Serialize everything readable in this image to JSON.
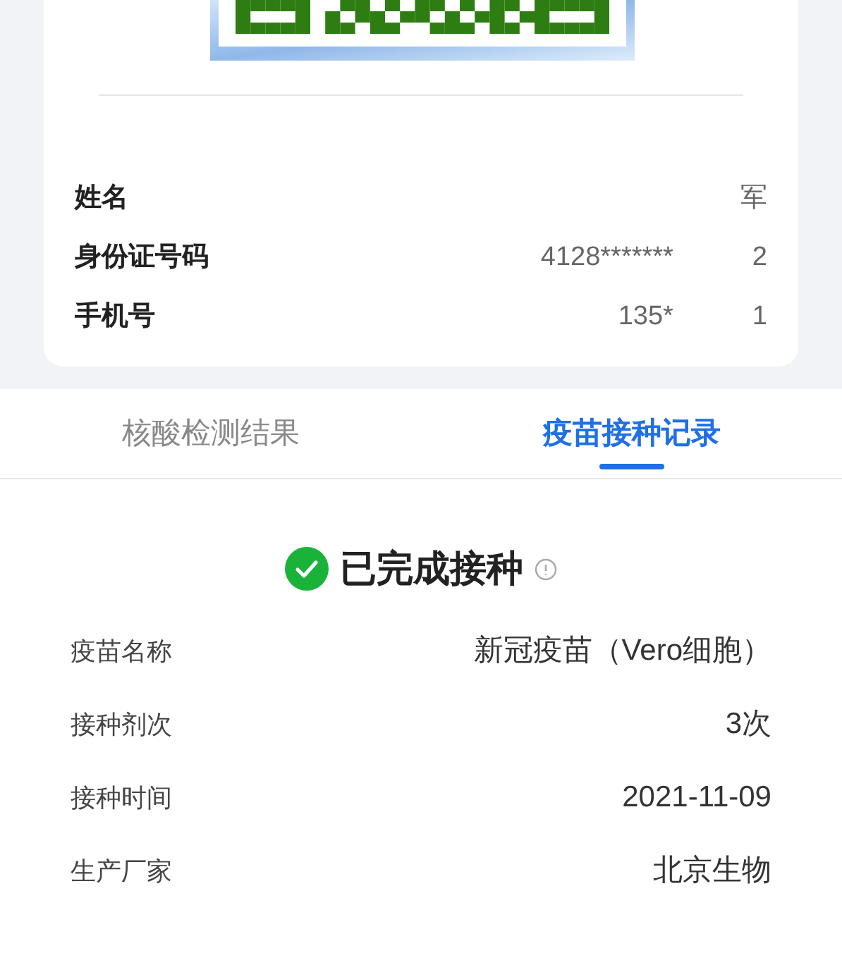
{
  "person": {
    "rows": [
      {
        "label": "姓名",
        "value_start": "",
        "value_end": "军"
      },
      {
        "label": "身份证号码",
        "value_start": "4128*******",
        "value_end": "2"
      },
      {
        "label": "手机号",
        "value_start": "135*",
        "value_end": "1"
      }
    ]
  },
  "tabs": [
    {
      "label": "核酸检测结果",
      "selected": false
    },
    {
      "label": "疫苗接种记录",
      "selected": true
    }
  ],
  "status": {
    "title": "已完成接种",
    "done": true
  },
  "records": [
    {
      "label": "疫苗名称",
      "value": "新冠疫苗（Vero细胞）"
    },
    {
      "label": "接种剂次",
      "value": "3次"
    },
    {
      "label": "接种时间",
      "value": "2021-11-09"
    },
    {
      "label": "生产厂家",
      "value": "北京生物"
    }
  ]
}
